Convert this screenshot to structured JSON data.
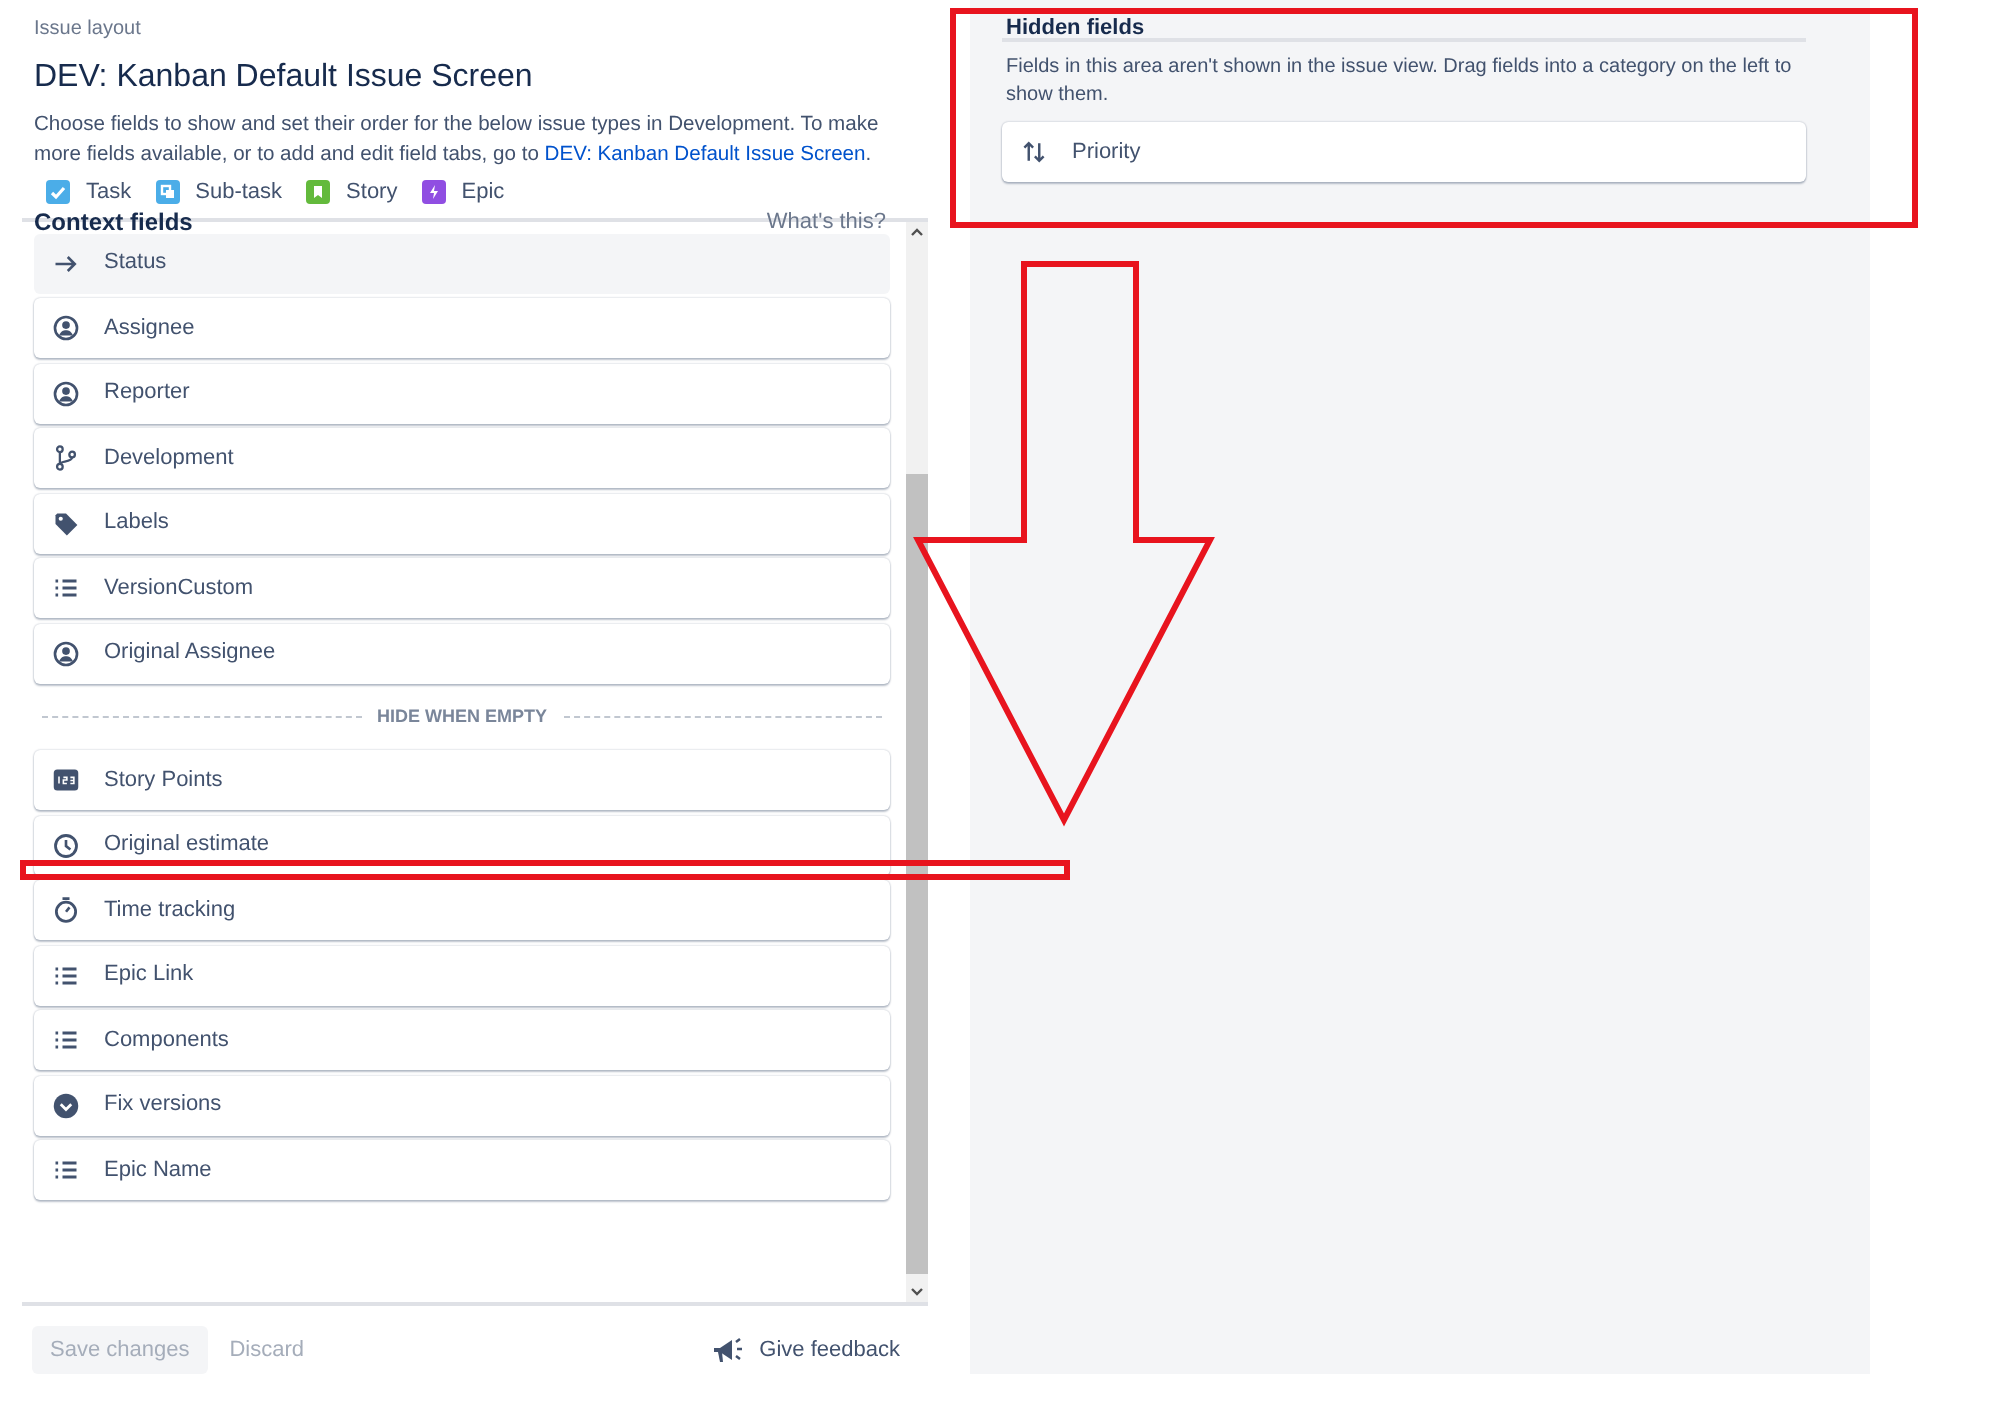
{
  "breadcrumb": "Issue layout",
  "title": "DEV: Kanban Default Issue Screen",
  "description": {
    "text": "Choose fields to show and set their order for the below issue types in Development. To make more fields available, or to add and edit field tabs, go to ",
    "link": "DEV: Kanban Default Issue Screen",
    "end": "."
  },
  "issue_types": [
    {
      "label": "Task",
      "kind": "check",
      "color": "#4bade8"
    },
    {
      "label": "Sub-task",
      "kind": "subtask",
      "color": "#4bade8"
    },
    {
      "label": "Story",
      "kind": "bookmark",
      "color": "#63ba3c"
    },
    {
      "label": "Epic",
      "kind": "bolt",
      "color": "#904ee2"
    }
  ],
  "context_section": {
    "title": "Context fields",
    "help": "What's this?",
    "fields": [
      {
        "label": "Status",
        "kind": "status",
        "locked": true
      },
      {
        "label": "Assignee",
        "kind": "user",
        "locked": false
      },
      {
        "label": "Reporter",
        "kind": "user",
        "locked": false
      },
      {
        "label": "Development",
        "kind": "development",
        "locked": false
      },
      {
        "label": "Labels",
        "kind": "labels",
        "locked": false
      },
      {
        "label": "VersionCustom",
        "kind": "select",
        "locked": false
      },
      {
        "label": "Original Assignee",
        "kind": "user",
        "locked": false
      }
    ],
    "divider": "HIDE WHEN EMPTY",
    "empty_fields": [
      {
        "label": "Story Points",
        "kind": "number",
        "locked": false
      },
      {
        "label": "Original estimate",
        "kind": "estimate",
        "locked": false
      },
      {
        "label": "Time tracking",
        "kind": "timetracking",
        "locked": false
      },
      {
        "label": "Epic Link",
        "kind": "select",
        "locked": false
      },
      {
        "label": "Components",
        "kind": "select",
        "locked": false
      },
      {
        "label": "Fix versions",
        "kind": "version",
        "locked": false
      },
      {
        "label": "Epic Name",
        "kind": "select",
        "locked": false
      }
    ]
  },
  "footer": {
    "buttons": [
      {
        "label": "Save changes",
        "kind": "primary",
        "disabled": true
      },
      {
        "label": "Discard",
        "kind": "subtle",
        "disabled": true
      }
    ],
    "feedback": "Give feedback"
  },
  "hidden_section": {
    "title": "Hidden fields",
    "description": "Fields in this area aren't shown in the issue view. Drag fields into a category on the left to show them.",
    "fields": [
      {
        "label": "Priority",
        "kind": "priority",
        "locked": false
      }
    ]
  }
}
